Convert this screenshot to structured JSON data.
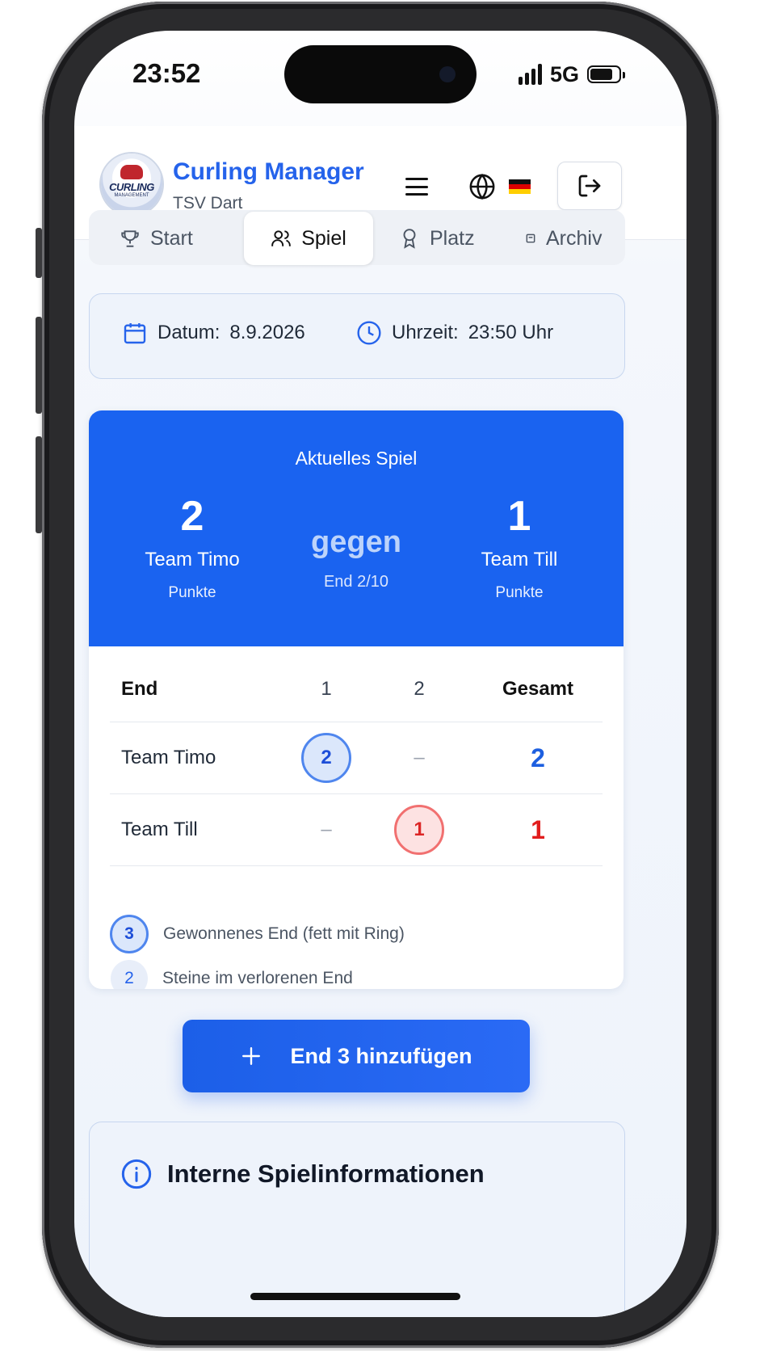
{
  "status": {
    "time": "23:52",
    "network": "5G"
  },
  "header": {
    "app_title": "Curling Manager",
    "club": "TSV Dart",
    "logo_text": "CURLING",
    "logo_sub": "MANAGEMENT",
    "language": "de"
  },
  "tabs": [
    {
      "label": "Start",
      "icon": "trophy-icon"
    },
    {
      "label": "Spiel",
      "icon": "users-icon",
      "active": true
    },
    {
      "label": "Platz",
      "icon": "award-icon"
    },
    {
      "label": "Archiv",
      "icon": "archive-icon"
    }
  ],
  "datetime": {
    "date_label": "Datum:",
    "date_value": "8.9.2026",
    "time_label": "Uhrzeit:",
    "time_value": "23:50 Uhr"
  },
  "game": {
    "title": "Aktuelles Spiel",
    "team_a": {
      "name": "Team Timo",
      "score": "2",
      "unit": "Punkte"
    },
    "team_b": {
      "name": "Team Till",
      "score": "1",
      "unit": "Punkte"
    },
    "vs": "gegen",
    "end_progress": "End 2/10"
  },
  "table": {
    "headers": {
      "name": "End",
      "end1": "1",
      "end2": "2",
      "total": "Gesamt"
    },
    "rows": [
      {
        "team": "Team Timo",
        "end1": "2",
        "end2": "–",
        "total": "2"
      },
      {
        "team": "Team Till",
        "end1": "–",
        "end2": "1",
        "total": "1"
      }
    ]
  },
  "legend": [
    {
      "badge": "3",
      "text": "Gewonnenes End (fett mit Ring)"
    },
    {
      "badge": "2",
      "text": "Steine im verlorenen End"
    }
  ],
  "add_button": {
    "label": "End 3 hinzufügen"
  },
  "info": {
    "title": "Interne Spielinformationen"
  },
  "colors": {
    "primary": "#1a63f0",
    "win_blue": "#1d5fe0",
    "win_red": "#e11d1d"
  }
}
